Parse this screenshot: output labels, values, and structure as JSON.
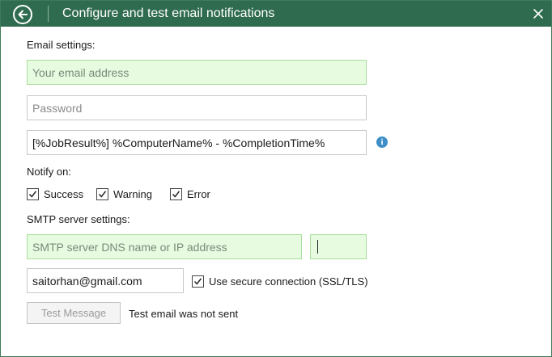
{
  "titlebar": {
    "title": "Configure and test email notifications",
    "back_icon": "back-arrow-circle-icon",
    "close_icon": "close-icon"
  },
  "email_settings": {
    "section_label": "Email settings:",
    "email_placeholder": "Your email address",
    "email_value": "",
    "password_placeholder": "Password",
    "password_value": "",
    "subject_value": "[%JobResult%] %ComputerName% - %CompletionTime%",
    "info_icon": "info-icon"
  },
  "notify": {
    "section_label": "Notify on:",
    "options": [
      {
        "label": "Success",
        "checked": true
      },
      {
        "label": "Warning",
        "checked": true
      },
      {
        "label": "Error",
        "checked": true
      }
    ]
  },
  "smtp": {
    "section_label": "SMTP server settings:",
    "server_placeholder": "SMTP server DNS name or IP address",
    "server_value": "",
    "port_value": "",
    "from_value": "saitorhan@gmail.com",
    "ssl_label": "Use secure connection (SSL/TLS)",
    "ssl_checked": true
  },
  "test": {
    "button_label": "Test Message",
    "status_text": "Test email was not sent"
  },
  "colors": {
    "titlebar": "#2f6b4f",
    "required_field_bg": "#e6fbe0",
    "info_icon": "#3d8ec9"
  }
}
